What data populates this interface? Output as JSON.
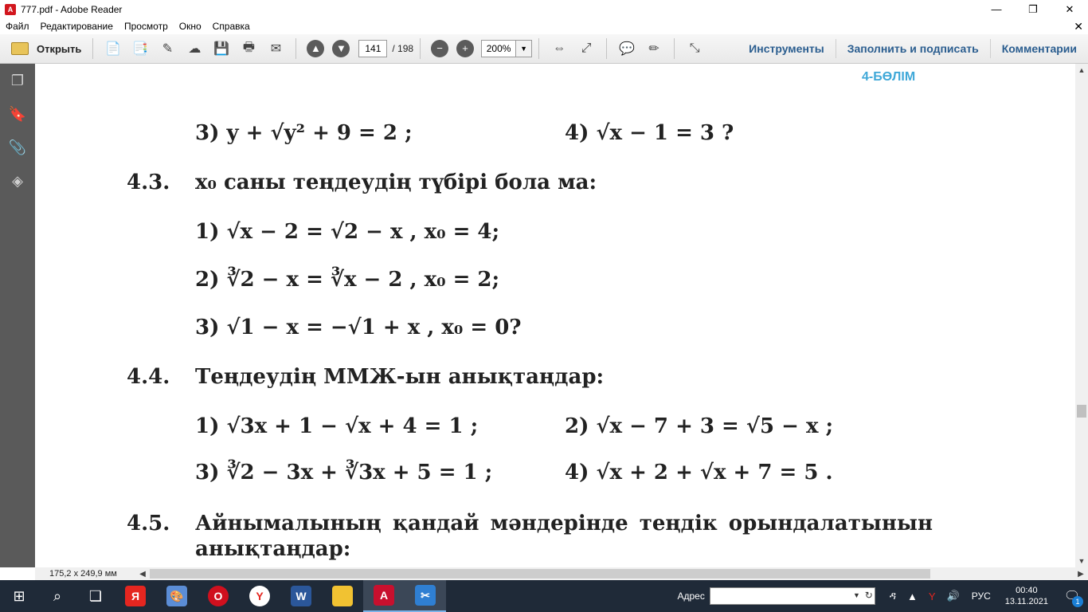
{
  "window": {
    "title": "777.pdf - Adobe Reader",
    "controls": {
      "minimize": "—",
      "maximize": "❐",
      "close": "✕"
    }
  },
  "menu": {
    "items": [
      "Файл",
      "Редактирование",
      "Просмотр",
      "Окно",
      "Справка"
    ],
    "close": "✕"
  },
  "toolbar": {
    "open_label": "Открыть",
    "page_current": "141",
    "page_total": "/ 198",
    "zoom": "200%",
    "zoom_dropdown": "▼",
    "links": [
      "Инструменты",
      "Заполнить и подписать",
      "Комментарии"
    ]
  },
  "document": {
    "section_header": "4-БӨЛІМ",
    "lines": [
      {
        "text": "3)  y + √y² + 9 = 2 ;"
      },
      {
        "text": "4)  √x − 1 = 3 ?"
      },
      {
        "num": "4.3.",
        "text": "x₀ саны теңдеудің түбірі бола ма:"
      },
      {
        "text": "1)  √x − 2 = √2 − x , x₀ = 4;"
      },
      {
        "text": "2)  ∛2 − x = ∛x − 2 , x₀ = 2;"
      },
      {
        "text": "3)  √1 − x = −√1 + x , x₀ = 0?"
      },
      {
        "num": "4.4.",
        "text": "Теңдеудің ММЖ-ын анықтаңдар:"
      },
      {
        "text": "1)  √3x + 1 − √x + 4 = 1 ;"
      },
      {
        "text": "2)  √x − 7 + 3 = √5 − x ;"
      },
      {
        "text": "3)  ∛2 − 3x + ∛3x + 5 = 1 ;"
      },
      {
        "text": "4)  √x + 2 + √x + 7 = 5 ."
      },
      {
        "num": "4.5.",
        "text": "Айнымалының қандай мәндерінде теңдік орындалатынын"
      },
      {
        "text": "анықтаңдар:"
      }
    ]
  },
  "statusbar": {
    "page_size": "175,2 x 249,9 мм"
  },
  "taskbar": {
    "address_label": "Адрес",
    "language": "РУС",
    "time": "00:40",
    "date": "13.11.2021",
    "notification_count": "1"
  }
}
